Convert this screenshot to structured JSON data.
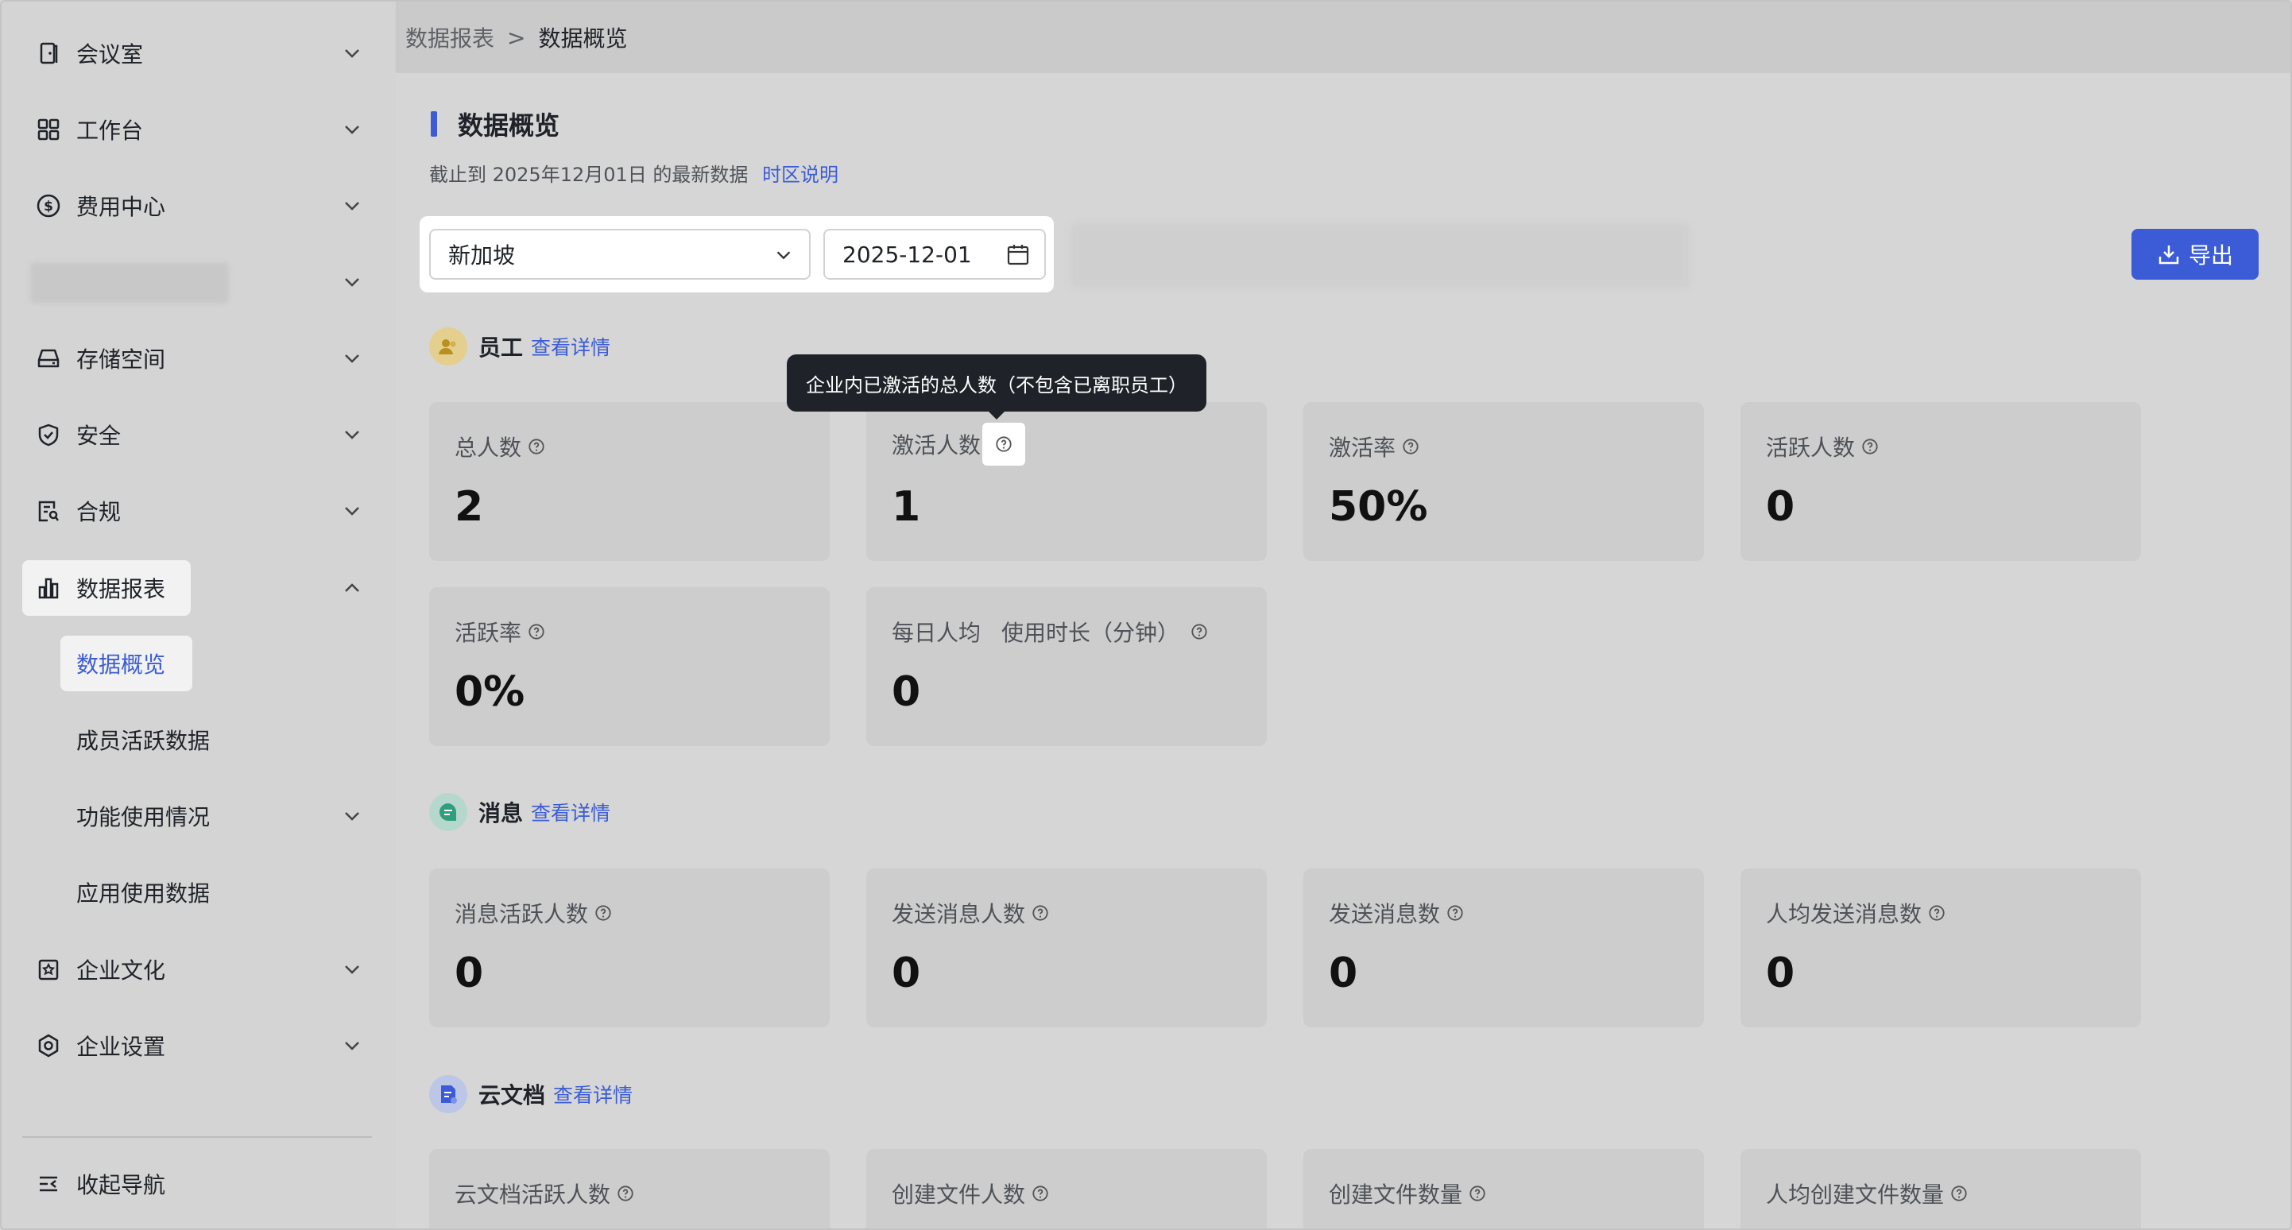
{
  "sidebar": {
    "items": [
      {
        "label": "会议室",
        "icon": "door-icon"
      },
      {
        "label": "工作台",
        "icon": "grid-icon"
      },
      {
        "label": "费用中心",
        "icon": "dollar-icon"
      },
      {
        "label": "",
        "icon": ""
      },
      {
        "label": "存储空间",
        "icon": "storage-icon"
      },
      {
        "label": "安全",
        "icon": "shield-icon"
      },
      {
        "label": "合规",
        "icon": "compliance-icon"
      },
      {
        "label": "数据报表",
        "icon": "bar-chart-icon"
      },
      {
        "label": "企业文化",
        "icon": "culture-icon"
      },
      {
        "label": "企业设置",
        "icon": "settings-icon"
      }
    ],
    "sub_items": [
      "数据概览",
      "成员活跃数据",
      "功能使用情况",
      "应用使用数据"
    ],
    "collapse_label": "收起导航"
  },
  "breadcrumb": {
    "parent": "数据报表",
    "separator": ">",
    "current": "数据概览"
  },
  "page": {
    "title": "数据概览",
    "subtitle": "截止到 2025年12月01日 的最新数据",
    "timezone_link": "时区说明"
  },
  "filters": {
    "region": "新加坡",
    "date": "2025-12-01"
  },
  "export_label": "导出",
  "sections": {
    "employees": {
      "title": "员工",
      "link": "查看详情",
      "cards": [
        {
          "label": "总人数",
          "value": "2"
        },
        {
          "label": "激活人数",
          "value": "1"
        },
        {
          "label": "激活率",
          "value": "50%"
        },
        {
          "label": "活跃人数",
          "value": "0"
        },
        {
          "label": "活跃率",
          "value": "0%"
        },
        {
          "label_a": "每日人均",
          "label_b": "使用时长（分钟）",
          "value": "0"
        }
      ]
    },
    "messages": {
      "title": "消息",
      "link": "查看详情",
      "cards": [
        {
          "label": "消息活跃人数",
          "value": "0"
        },
        {
          "label": "发送消息人数",
          "value": "0"
        },
        {
          "label": "发送消息数",
          "value": "0"
        },
        {
          "label": "人均发送消息数",
          "value": "0"
        }
      ]
    },
    "docs": {
      "title": "云文档",
      "link": "查看详情",
      "cards": [
        {
          "label": "云文档活跃人数"
        },
        {
          "label": "创建文件人数"
        },
        {
          "label": "创建文件数量"
        },
        {
          "label": "人均创建文件数量"
        }
      ]
    }
  },
  "tooltip": "企业内已激活的总人数（不包含已离职员工）",
  "colors": {
    "accent": "#3b5cd6",
    "tooltip_bg": "#1f2329"
  }
}
